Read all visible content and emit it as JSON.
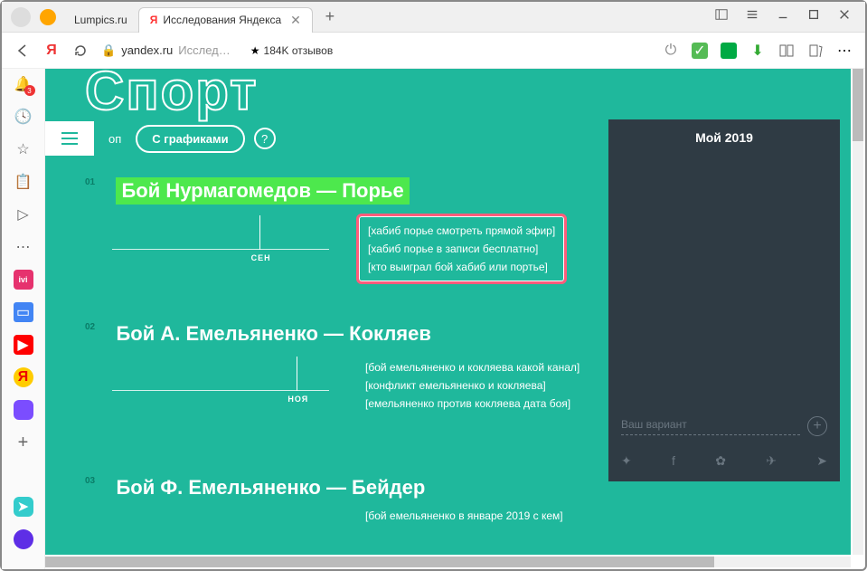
{
  "titlebar": {
    "tab1": "Lumpics.ru",
    "tab2": "Исследования Яндекса",
    "close": "✕"
  },
  "addressbar": {
    "domain": "yandex.ru",
    "path": "Исслед…",
    "reviews": "184K отзывов"
  },
  "sidebar": {
    "badge": "3"
  },
  "page": {
    "sport_title": "Спорт",
    "filter_inactive": "оп",
    "filter_active": "С графиками",
    "filter_help": "?"
  },
  "items": [
    {
      "num": "01",
      "title": "Бой Нурмагомедов — Порье",
      "month_label": "СЕН",
      "queries": [
        "[хабиб порье смотреть прямой эфир]",
        "[хабиб порье в записи бесплатно]",
        "[кто выиграл бой хабиб или портье]"
      ]
    },
    {
      "num": "02",
      "title": "Бой А. Емельяненко — Кокляев",
      "month_label": "НОЯ",
      "queries": [
        "[бой емельяненко и кокляева какой канал]",
        "[конфликт емельяненко и кокляева]",
        "[емельяненко против кокляева дата боя]"
      ]
    },
    {
      "num": "03",
      "title": "Бой Ф. Емельяненко — Бейдер",
      "queries": [
        "[бой емельяненко в январе 2019 с кем]"
      ]
    }
  ],
  "right_panel": {
    "title": "Мой 2019",
    "placeholder": "Ваш вариант"
  },
  "chart_data": [
    {
      "type": "line",
      "title": "item 01 sparkline",
      "peak_month": "СЕН",
      "peak_position_pct": 68
    },
    {
      "type": "line",
      "title": "item 02 sparkline",
      "peak_month": "НОЯ",
      "peak_position_pct": 85
    }
  ]
}
